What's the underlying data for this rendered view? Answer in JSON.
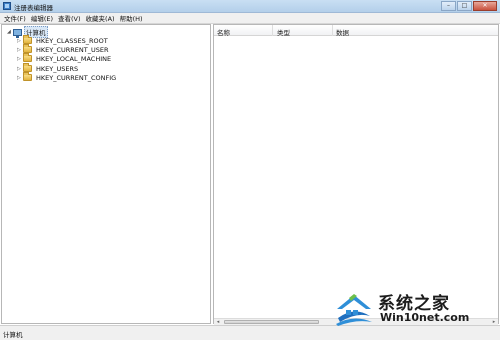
{
  "window": {
    "title": "注册表编辑器",
    "controls": {
      "minimize": "–",
      "maximize": "□",
      "close": "✕"
    }
  },
  "menu": [
    "文件(F)",
    "编辑(E)",
    "查看(V)",
    "收藏夹(A)",
    "帮助(H)"
  ],
  "tree": {
    "root_label": "计算机",
    "nodes": [
      "HKEY_CLASSES_ROOT",
      "HKEY_CURRENT_USER",
      "HKEY_LOCAL_MACHINE",
      "HKEY_USERS",
      "HKEY_CURRENT_CONFIG"
    ],
    "expanded_glyph": "◢",
    "collapsed_glyph": "▷"
  },
  "list": {
    "columns": [
      "名称",
      "类型",
      "数据"
    ]
  },
  "scrollbar": {
    "left_arrow": "◂",
    "right_arrow": "▸"
  },
  "status": {
    "text": "计算机"
  },
  "watermark": {
    "brand": "系统之家",
    "url": "Win10net.com"
  },
  "colors": {
    "title_bar": "#c9dff3",
    "selection": "#d9e8f7",
    "folder": "#f8dd86"
  },
  "icons": [
    "regedit-app-icon",
    "computer-icon",
    "folder-icon",
    "expand-arrow-icon"
  ]
}
